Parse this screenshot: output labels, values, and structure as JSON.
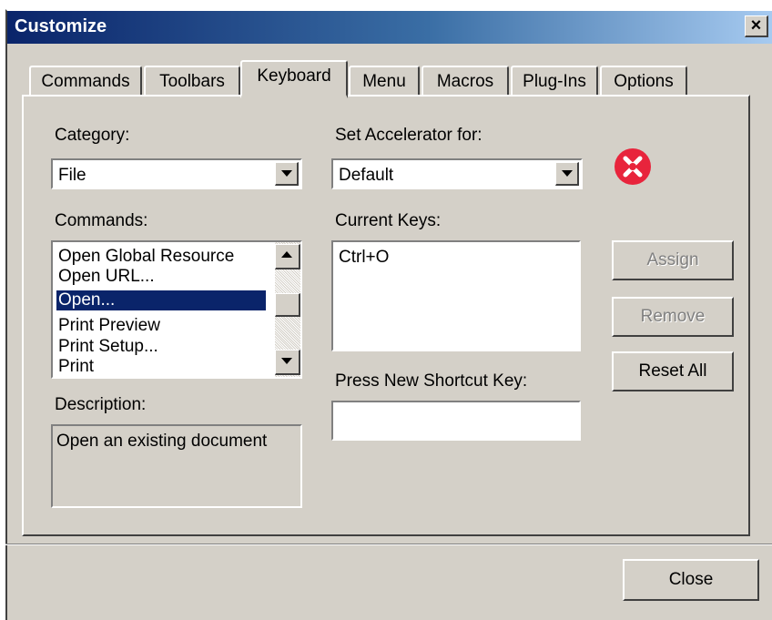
{
  "window": {
    "title": "Customize",
    "close_glyph": "×"
  },
  "tabs": [
    {
      "label": "Commands"
    },
    {
      "label": "Toolbars"
    },
    {
      "label": "Keyboard",
      "active": true
    },
    {
      "label": "Menu"
    },
    {
      "label": "Macros"
    },
    {
      "label": "Plug-Ins"
    },
    {
      "label": "Options"
    }
  ],
  "category": {
    "label": "Category:",
    "value": "File"
  },
  "accelerator": {
    "label": "Set Accelerator for:",
    "value": "Default"
  },
  "commands": {
    "label": "Commands:",
    "items": [
      "Open Global Resource",
      "Open URL...",
      "Open...",
      "Print Preview",
      "Print Setup...",
      "Print"
    ],
    "selected": "Open..."
  },
  "current_keys": {
    "label": "Current Keys:",
    "items": [
      "Ctrl+O"
    ]
  },
  "new_shortcut": {
    "label": "Press New Shortcut Key:",
    "value": ""
  },
  "description": {
    "label": "Description:",
    "text": "Open an existing document"
  },
  "buttons": {
    "assign": "Assign",
    "remove": "Remove",
    "reset_all": "Reset All",
    "close": "Close"
  },
  "icons": {
    "delete": "x-circle-icon",
    "delete_color": "#e8243c"
  }
}
